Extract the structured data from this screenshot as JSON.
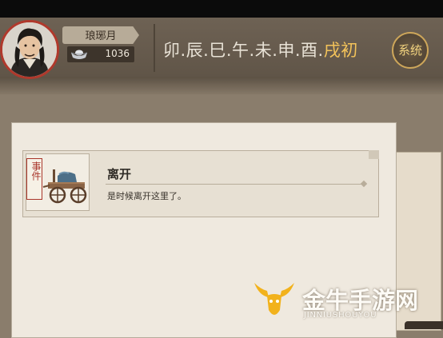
{
  "player": {
    "name": "琅琊月",
    "silver": "1036",
    "avatar_icon": "portrait-icon",
    "silver_icon": "silver-ingot-icon"
  },
  "clock": {
    "past_hours": "卯.辰.巳.午.未.申.酉.",
    "current_hour": "戌初"
  },
  "system_button": {
    "label": "系统"
  },
  "event": {
    "tag": "事件",
    "title": "离开",
    "description": "是时候离开这里了。",
    "image_icon": "cart-icon"
  },
  "watermark": {
    "title": "金牛手游网",
    "subtitle": "JINNIUSHOUYOU"
  },
  "colors": {
    "accent_gold": "#f3c35a",
    "seal_red": "#a9362b",
    "panel_bg": "#efe9df"
  }
}
